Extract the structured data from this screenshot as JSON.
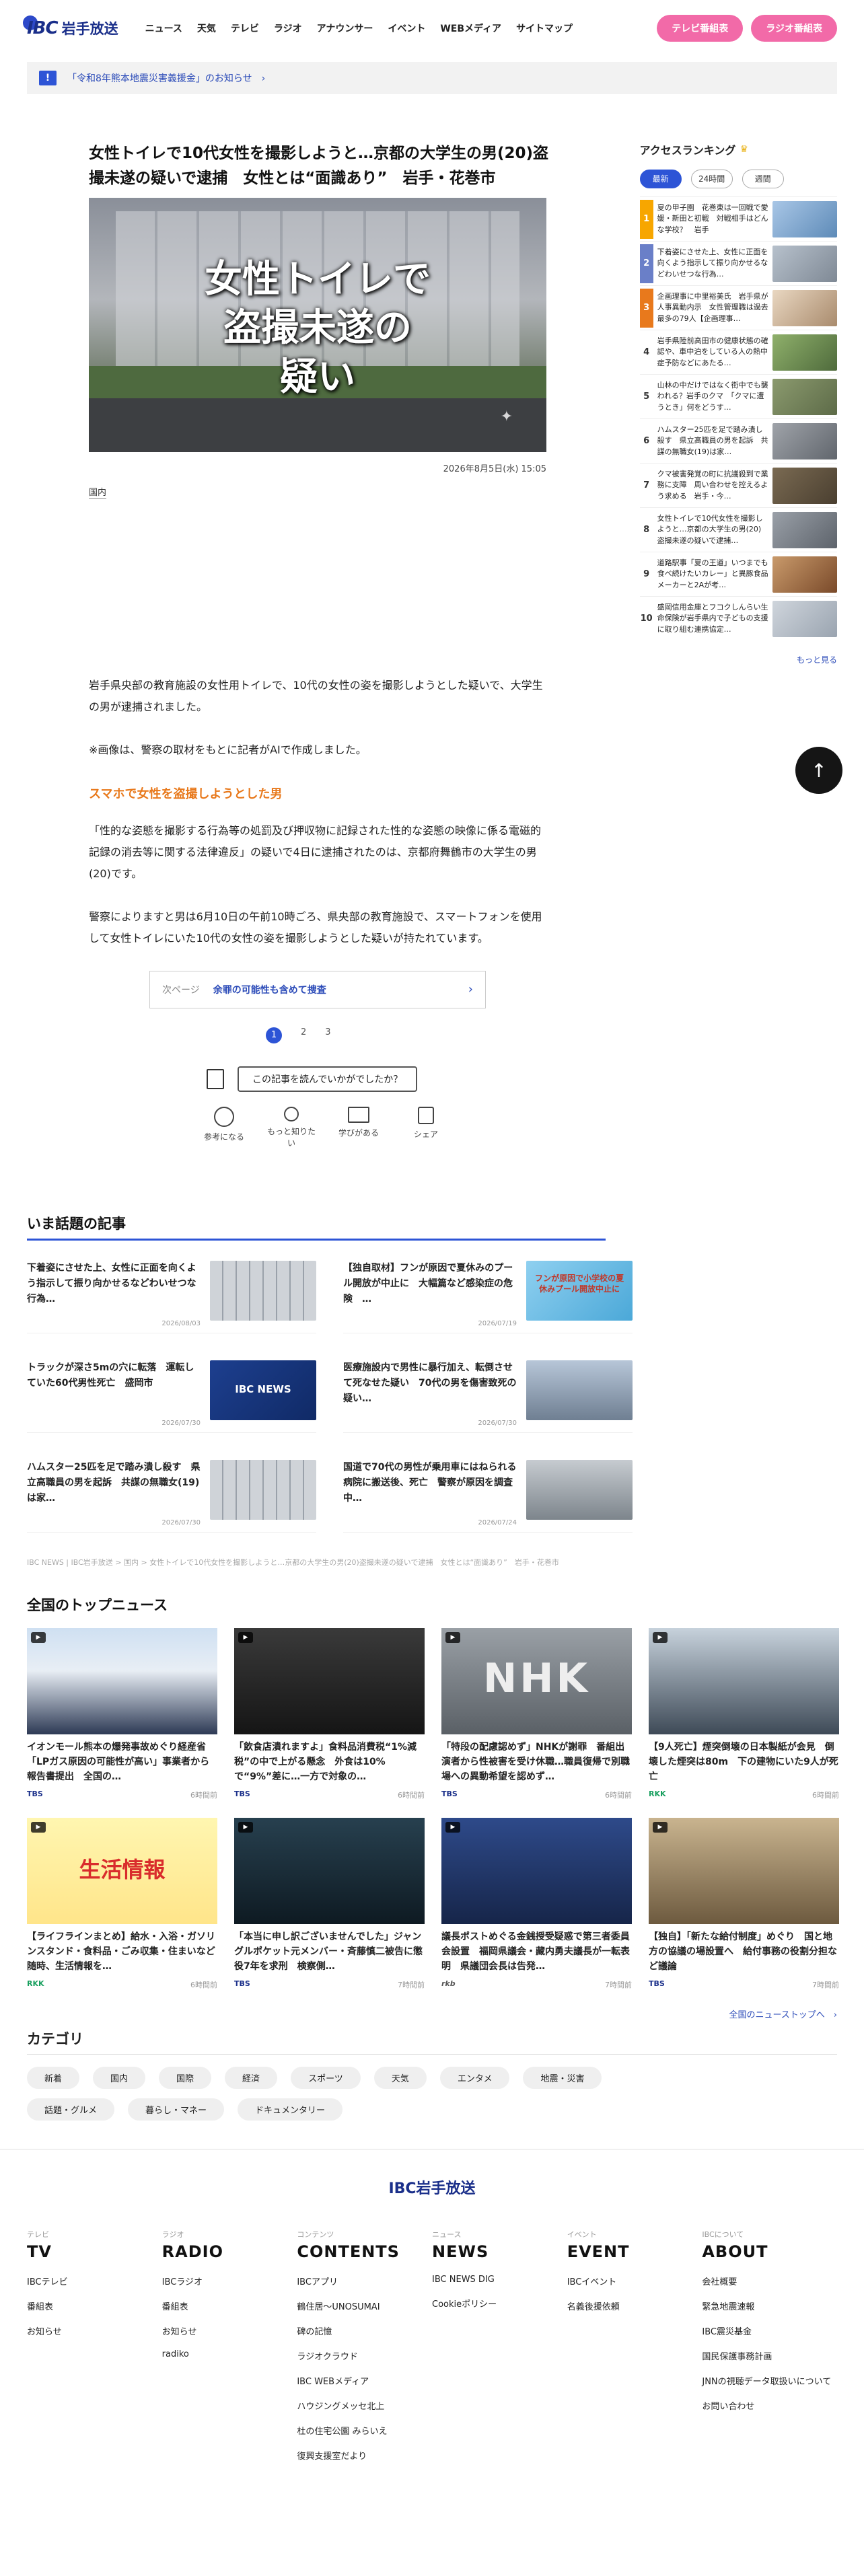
{
  "header": {
    "logo_mark": "IBC",
    "logo_text": "岩手放送",
    "nav": [
      "ニュース",
      "天気",
      "テレビ",
      "ラジオ",
      "アナウンサー",
      "イベント",
      "WEBメディア",
      "サイトマップ"
    ],
    "tv_button": "テレビ番組表",
    "radio_button": "ラジオ番組表"
  },
  "notice": {
    "icon": "!",
    "text": "「令和8年熊本地震災害義援金」のお知らせ　›"
  },
  "article": {
    "title": "女性トイレで10代女性を撮影しようと…京都の大学生の男(20)盗撮未遂の疑いで逮捕　女性とは“面識あり”　岩手・花巻市",
    "hero_caption_line1": "女性トイレで",
    "hero_caption_line2": "盗撮未遂の",
    "hero_caption_line3": "疑い",
    "date": "2026年8月5日(水) 15:05",
    "category": "国内",
    "paragraph1": "岩手県央部の教育施設の女性用トイレで、10代の女性の姿を撮影しようとした疑いで、大学生の男が逮捕されました。",
    "paragraph2": "※画像は、警察の取材をもとに記者がAIで作成しました。",
    "section_heading": "スマホで女性を盗撮しようとした男",
    "paragraph3": "「性的な姿態を撮影する行為等の処罰及び押収物に記録された性的な姿態の映像に係る電磁的記録の消去等に関する法律違反」の疑いで4日に逮捕されたのは、京都府舞鶴市の大学生の男(20)です。",
    "paragraph4": "警察によりますと男は6月10日の午前10時ごろ、県央部の教育施設で、スマートフォンを使用して女性トイレにいた10代の女性の姿を撮影しようとした疑いが持たれています。",
    "next_label": "次ページ",
    "next_text": "余罪の可能性も含めて捜査",
    "pages": [
      "1",
      "2",
      "3"
    ],
    "feedback_question": "この記事を読んでいかがでしたか？",
    "reactions": [
      "参考になる",
      "もっと知りたい",
      "学びがある",
      "シェア"
    ]
  },
  "ranking": {
    "title": "アクセスランキング",
    "tabs": [
      "最新",
      "24時間",
      "週間"
    ],
    "items": [
      {
        "no": "1",
        "text": "夏の甲子園　花巻東は一回戦で愛媛・新田と初戦　対戦相手はどんな学校？　岩手"
      },
      {
        "no": "2",
        "text": "下着姿にさせた上、女性に正面を向くよう指示して振り向かせるなどわいせつな行為…"
      },
      {
        "no": "3",
        "text": "企画理事に中里裕美氏　岩手県が人事異動内示　女性管理職は過去最多の79人【企画理事…"
      },
      {
        "no": "4",
        "text": "岩手県陸前高田市の健康状態の確認や、車中泊をしている人の熱中症予防などにあたる…"
      },
      {
        "no": "5",
        "text": "山林の中だけではなく街中でも襲われる？岩手のクマ　「クマに遭うとき」何をどうす…"
      },
      {
        "no": "6",
        "text": "ハムスター25匹を足で踏み潰し殺す　県立高職員の男を起訴　共謀の無職女(19)は家…"
      },
      {
        "no": "7",
        "text": "クマ被害発覚の町に抗議殺到で業務に支障　周い合わせを控えるよう求める　岩手・今…"
      },
      {
        "no": "8",
        "text": "女性トイレで10代女性を撮影しようと…京都の大学生の男(20)盗撮未遂の疑いで逮捕…"
      },
      {
        "no": "9",
        "text": "道路駅事「夏の王道」いつまでも食べ続けたいカレー」と異豚食品メーカーと2Aが考…"
      },
      {
        "no": "10",
        "text": "盛岡信用金庫とフコクしんらい生命保険が岩手県内で子どもの支援に取り組む連携協定…"
      }
    ],
    "more": "もっと見る"
  },
  "totop": "↑",
  "topics": {
    "title": "いま話題の記事",
    "items": [
      {
        "text": "下着姿にさせた上、女性に正面を向くよう指示して振り向かせるなどわいせつな行為…",
        "date": "2026/08/03"
      },
      {
        "text": "【独自取材】フンが原因で夏休みのプール開放が中止に　大幅篇など感染症の危険　…",
        "date": "2026/07/19"
      },
      {
        "text": "トラックが深さ5mの穴に転落　運転していた60代男性死亡　盛岡市",
        "date": "2026/07/30"
      },
      {
        "text": "医療施設内で男性に暴行加え、転倒させて死なせた疑い　70代の男を傷害致死の疑い…",
        "date": "2026/07/30"
      },
      {
        "text": "ハムスター25匹を足で踏み潰し殺す　県立高職員の男を起訴　共謀の無職女(19)は家…",
        "date": "2026/07/30"
      },
      {
        "text": "国道で70代の男性が乗用車にはねられる　病院に搬送後、死亡　警察が原因を調査中…",
        "date": "2026/07/24"
      }
    ],
    "thumb2_caption": "フンが原因で小学校の夏休みプール開放中止に",
    "thumb3_caption": "IBC NEWS"
  },
  "breadcrumb": "IBC NEWS | IBC岩手放送 > 国内 > 女性トイレで10代女性を撮影しようと…京都の大学生の男(20)盗撮未遂の疑いで逮捕　女性とは“面識あり”　岩手・花巻市",
  "national": {
    "title": "全国のトップニュース",
    "items": [
      {
        "text": "イオンモール熊本の爆発事故めぐり経産省「LPガス原因の可能性が高い」事業者から報告書提出　全国の…",
        "src": "TBS",
        "ago": "6時間前",
        "cls": "tbs"
      },
      {
        "text": "「飲食店潰れますよ」食料品消費税“1%減税”の中で上がる懸念　外食は10%で“9%”差に…一方で対象の…",
        "src": "TBS",
        "ago": "6時間前",
        "cls": "tbs"
      },
      {
        "text": "「特段の配慮認めず」NHKが謝罪　番組出演者から性被害を受け休職…職員復帰で別職場への異動希望を認めず…",
        "src": "TBS",
        "ago": "6時間前",
        "cls": "tbs"
      },
      {
        "text": "【9人死亡】煙突倒壊の日本製紙が会見　倒壊した煙突は80m　下の建物にいた9人が死亡",
        "src": "RKK",
        "ago": "6時間前",
        "cls": "rkk"
      },
      {
        "text": "【ライフラインまとめ】給水・入浴・ガソリンスタンド・食料品・ごみ収集・住まいなど　随時、生活情報を…",
        "src": "RKK",
        "ago": "6時間前",
        "cls": "rkk"
      },
      {
        "text": "「本当に申し訳ございませんでした」ジャングルポケット元メンバー・斉藤慎二被告に懲役7年を求刑　検察側…",
        "src": "TBS",
        "ago": "7時間前",
        "cls": "tbs"
      },
      {
        "text": "議長ポストめぐる金銭授受疑惑で第三者委員会設置　福岡県議会・藏内勇夫議長が一転表明　県議団会長は告発…",
        "src": "rkb",
        "ago": "7時間前",
        "cls": "rkb"
      },
      {
        "text": "【独自】「新たな給付制度」めぐり　国と地方の協議の場設置へ　給付事務の役割分担など議論",
        "src": "TBS",
        "ago": "7時間前",
        "cls": "tbs"
      }
    ],
    "all_link": "全国のニューストップへ　›",
    "img5_caption": "生活情報",
    "img3_caption": "NHK"
  },
  "categories": {
    "title": "カテゴリ",
    "items": [
      "新着",
      "国内",
      "国際",
      "経済",
      "スポーツ",
      "天気",
      "エンタメ",
      "地震・災害",
      "話題・グルメ",
      "暮らし・マネー",
      "ドキュメンタリー"
    ]
  },
  "footer": {
    "logo": "IBC岩手放送",
    "cols": [
      {
        "sm": "テレビ",
        "big": "TV",
        "links": [
          "IBCテレビ",
          "番組表",
          "お知らせ"
        ]
      },
      {
        "sm": "ラジオ",
        "big": "RADIO",
        "links": [
          "IBCラジオ",
          "番組表",
          "お知らせ",
          "radiko"
        ]
      },
      {
        "sm": "コンテンツ",
        "big": "CONTENTS",
        "links": [
          "IBCアプリ",
          "鶴住居～UNOSUMAI",
          "碑の記憶",
          "ラジオクラウド",
          "IBC WEBメディア",
          "ハウジングメッセ北上",
          "杜の住宅公園 みらいえ",
          "復興支援室だより"
        ]
      },
      {
        "sm": "ニュース",
        "big": "NEWS",
        "links": [
          "IBC NEWS DIG",
          "Cookieポリシー"
        ]
      },
      {
        "sm": "イベント",
        "big": "EVENT",
        "links": [
          "IBCイベント",
          "名義後援依頼"
        ]
      },
      {
        "sm": "IBCについて",
        "big": "ABOUT",
        "links": [
          "会社概要",
          "緊急地震速報",
          "IBC震災基金",
          "国民保護事務計画",
          "JNNの視聴データ取扱いについて",
          "お問い合わせ"
        ]
      }
    ]
  },
  "colors": {
    "accent": "#2d54d6",
    "pink": "#f26aa8",
    "orange": "#e8791c"
  }
}
